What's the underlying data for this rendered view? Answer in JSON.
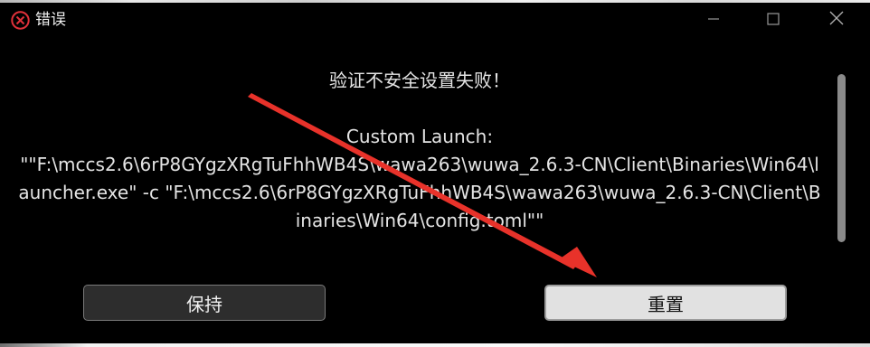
{
  "window": {
    "title": "错误",
    "title_icon": "error-circle-x-icon",
    "controls": {
      "minimize": "minimize-icon",
      "maximize": "maximize-icon",
      "close": "close-icon"
    }
  },
  "message": {
    "heading": "验证不安全设置失败！",
    "line1": "Custom Launch:",
    "line2": "\"\"F:\\mccs2.6\\6rP8GYgzXRgTuFhhWB4S\\wawa263\\wuwa_2.6.3-CN\\Client\\Binaries\\Win64\\launcher.exe\" -c \"F:\\mccs2.6\\6rP8GYgzXRgTuFhhWB4S\\wawa263\\wuwa_2.6.3-CN\\Client\\Binaries\\Win64\\config.toml\"\""
  },
  "buttons": {
    "keep": "保持",
    "reset": "重置"
  },
  "colors": {
    "background": "#000000",
    "text": "#e4e4e4",
    "error_icon": "#e0313a",
    "annotation_arrow": "#e8322a",
    "reset_button_bg": "#e1e1e1",
    "keep_button_bg": "#2d2d2d"
  }
}
